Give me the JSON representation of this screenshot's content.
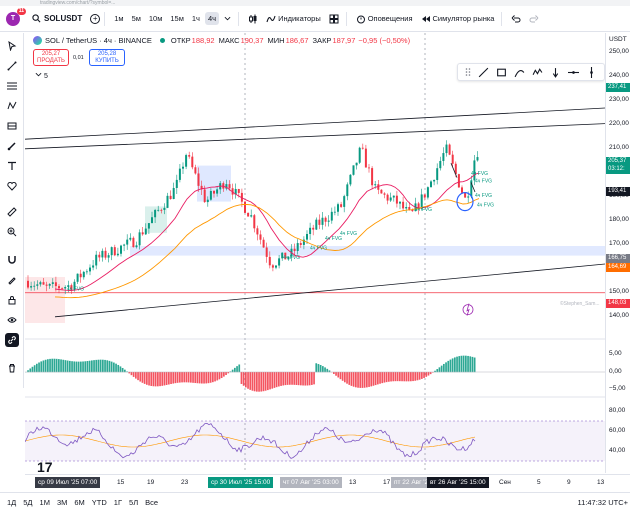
{
  "browser": {
    "url": "tradingview.com/chart/?symbol=..."
  },
  "header": {
    "avatar_letter": "T",
    "notifications": "11",
    "symbol": "SOLUSDT",
    "timeframes": [
      "1м",
      "5м",
      "10м",
      "15м",
      "1ч",
      "4ч"
    ],
    "active_timeframe": "4ч",
    "indicators_label": "Индикаторы",
    "alerts_label": "Оповещения",
    "replay_label": "Симулятор рынка"
  },
  "legend": {
    "title": "SOL / TetherUS · 4ч · BINANCE",
    "open_label": "ОТКР",
    "open_value": "188,92",
    "high_label": "МАКС",
    "high_value": "190,37",
    "low_label": "МИН",
    "low_value": "186,67",
    "close_label": "ЗАКР",
    "close_value": "187,97",
    "change_value": "−0,95 (−0,50%)",
    "sell_price": "205,27",
    "sell_label": "ПРОДАТЬ",
    "buy_price": "205,28",
    "buy_label": "КУПИТЬ",
    "spread": "0,01",
    "indicator_count": "5"
  },
  "annotations": {
    "fvg_label": "4ч FVG",
    "watermark": "©Stephen_Sam..."
  },
  "price_axis": {
    "currency": "USDT",
    "ticks": [
      "250,00",
      "240,00",
      "230,00",
      "220,00",
      "210,00",
      "200,00",
      "190,00",
      "180,00",
      "170,00",
      "160,00",
      "150,00",
      "140,00"
    ],
    "badges": [
      {
        "text": "237,41",
        "color": "#089981"
      },
      {
        "text": "205,37",
        "color": "#089981"
      },
      {
        "text": "03:12:",
        "color": "#089981"
      },
      {
        "text": "193,41",
        "color": "#131722"
      },
      {
        "text": "166,75",
        "color": "#787b86"
      },
      {
        "text": "164,69",
        "color": "#ff6d00"
      },
      {
        "text": "148,03",
        "color": "#f23645"
      }
    ],
    "macd_ticks": [
      "5,00",
      "0,00",
      "−5,00"
    ],
    "rsi_ticks": [
      "80,00",
      "60,00",
      "40,00"
    ]
  },
  "time_axis": {
    "ticks": [
      "15",
      "19",
      "23",
      "13",
      "17",
      "Сен",
      "5",
      "9",
      "13"
    ],
    "badges": [
      {
        "text": "ср 09 Июл '25  07:00",
        "color": "#363a45"
      },
      {
        "text": "ср 30 Июл '25  15:00",
        "color": "#089981"
      },
      {
        "text": "чт 07 Авг '25  03:00",
        "color": "#b2b5be"
      },
      {
        "text": "пт 22 Авг '25",
        "color": "#b2b5be"
      },
      {
        "text": "вт 26 Авг '25  15:00",
        "color": "#131722"
      }
    ]
  },
  "bottombar": {
    "ranges": [
      "1Д",
      "5Д",
      "1М",
      "3М",
      "6М",
      "YTD",
      "1Г",
      "5Л",
      "Все"
    ],
    "clock": "11:47:32 UTC+"
  },
  "colors": {
    "up": "#089981",
    "down": "#f23645",
    "ma_fast": "#e91e63",
    "ma_slow": "#ff9800",
    "rsi": "#7e57c2"
  }
}
